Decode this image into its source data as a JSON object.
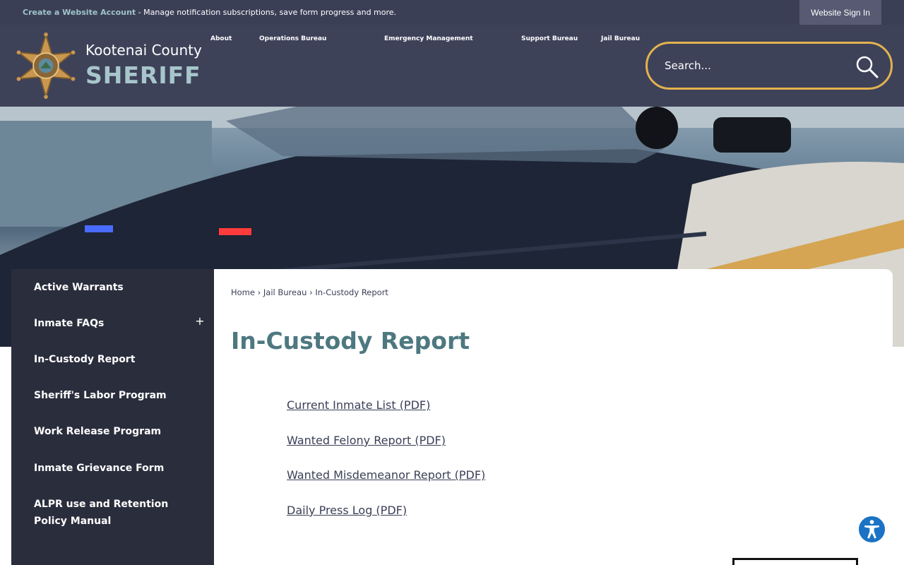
{
  "topbar": {
    "create_link": "Create a Website Account",
    "message": " - Manage notification subscriptions, save form progress and more.",
    "signin_label": "Website Sign In"
  },
  "header": {
    "brand_top": "Kootenai County",
    "brand_main": "SHERIFF",
    "nav": [
      "About",
      "Operations Bureau",
      "Emergency Management",
      "Support Bureau",
      "Jail Bureau"
    ],
    "search_placeholder": "Search..."
  },
  "sidebar": {
    "items": [
      "Active Warrants",
      "Inmate FAQs",
      "In-Custody Report",
      "Sheriff's Labor Program",
      "Work Release Program",
      "Inmate Grievance Form",
      "ALPR use and Retention Policy Manual"
    ],
    "expand_glyph": "+"
  },
  "breadcrumb": {
    "home": "Home",
    "sep": "›",
    "section": "Jail Bureau",
    "current": "In-Custody Report"
  },
  "page_title": "In-Custody Report",
  "documents": [
    "Current Inmate List (PDF)",
    "Wanted Felony Report (PDF)",
    "Wanted Misdemeanor Report (PDF)",
    "Daily Press Log (PDF)"
  ],
  "colors": {
    "topbar": "#3b3f56",
    "header": "#3e4259",
    "sidebar": "#2a2d3c",
    "accent_gold": "#e3b24e",
    "title_teal": "#4d7880"
  },
  "icons": {
    "badge": "sheriff-star-badge",
    "search": "magnifier-icon",
    "accessibility": "accessibility-person-icon"
  }
}
